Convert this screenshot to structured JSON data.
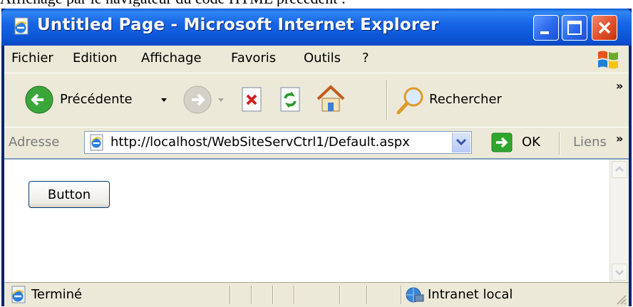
{
  "caption": "Affichage par le navigateur du code HTML précédent :",
  "window": {
    "title": "Untitled Page - Microsoft Internet Explorer",
    "buttons": [
      "minimize-icon",
      "maximize-icon",
      "close-icon"
    ]
  },
  "menu": {
    "items": [
      {
        "label": "Fichier"
      },
      {
        "label": "Edition"
      },
      {
        "label": "Affichage"
      },
      {
        "label": "Favoris"
      },
      {
        "label": "Outils"
      },
      {
        "label": "?"
      }
    ]
  },
  "toolbar": {
    "back_label": "Précédente",
    "search_label": "Rechercher",
    "more": "»"
  },
  "address": {
    "label": "Adresse",
    "url": "http://localhost/WebSiteServCtrl1/Default.aspx",
    "go_label": "OK",
    "links_label": "Liens",
    "more": "»"
  },
  "page": {
    "button_label": "Button"
  },
  "status": {
    "text": "Terminé",
    "zone": "Intranet local"
  },
  "colors": {
    "titlebar": "#0a53d3",
    "chrome": "#ece9d8",
    "close_button": "#e0502c"
  }
}
